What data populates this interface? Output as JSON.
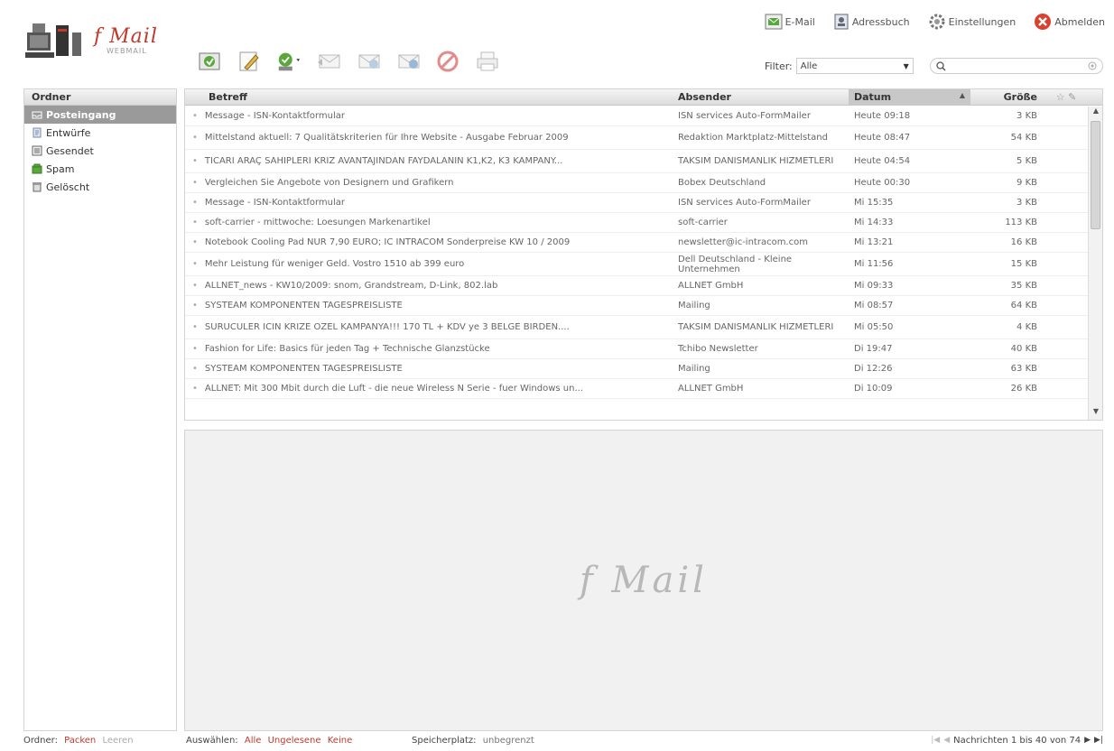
{
  "logo": {
    "name": "f Mail",
    "sub": "WEBMAIL"
  },
  "topnav": [
    {
      "label": "E-Mail",
      "icon": "email-icon"
    },
    {
      "label": "Adressbuch",
      "icon": "addressbook-icon"
    },
    {
      "label": "Einstellungen",
      "icon": "settings-icon"
    },
    {
      "label": "Abmelden",
      "icon": "logout-icon"
    }
  ],
  "filter": {
    "label": "Filter:",
    "value": "Alle"
  },
  "search": {
    "placeholder": ""
  },
  "folders": {
    "header": "Ordner",
    "items": [
      {
        "label": "Posteingang",
        "icon": "inbox-icon"
      },
      {
        "label": "Entwürfe",
        "icon": "drafts-icon"
      },
      {
        "label": "Gesendet",
        "icon": "sent-icon"
      },
      {
        "label": "Spam",
        "icon": "spam-icon"
      },
      {
        "label": "Gelöscht",
        "icon": "trash-icon"
      }
    ]
  },
  "list": {
    "columns": {
      "subject": "Betreff",
      "sender": "Absender",
      "date": "Datum",
      "size": "Größe"
    },
    "rows": [
      {
        "subject": "Message - ISN-Kontaktformular",
        "sender": "ISN services Auto-FormMailer",
        "date": "Heute 09:18",
        "size": "3 KB"
      },
      {
        "subject": "Mittelstand aktuell: 7 Qualitätskriterien für Ihre Website - Ausgabe Februar 2009",
        "sender": "Redaktion Marktplatz-Mittelstand",
        "date": "Heute 08:47",
        "size": "54 KB"
      },
      {
        "subject": "TICARI ARAÇ SAHIPLERI KRIZ AVANTAJINDAN FAYDALANIN K1,K2, K3 KAMPANY...",
        "sender": "TAKSIM DANISMANLIK HIZMETLERI",
        "date": "Heute 04:54",
        "size": "5 KB"
      },
      {
        "subject": "Vergleichen Sie Angebote von Designern und Grafikern",
        "sender": "Bobex Deutschland",
        "date": "Heute 00:30",
        "size": "9 KB"
      },
      {
        "subject": "Message - ISN-Kontaktformular",
        "sender": "ISN services Auto-FormMailer",
        "date": "Mi 15:35",
        "size": "3 KB"
      },
      {
        "subject": "soft-carrier - mittwoche: Loesungen Markenartikel",
        "sender": "soft-carrier",
        "date": "Mi 14:33",
        "size": "113 KB"
      },
      {
        "subject": "Notebook Cooling Pad NUR 7,90 EURO; IC INTRACOM Sonderpreise KW 10 / 2009",
        "sender": "newsletter@ic-intracom.com",
        "date": "Mi 13:21",
        "size": "16 KB"
      },
      {
        "subject": "Mehr Leistung für weniger Geld. Vostro 1510 ab 399 euro",
        "sender": "Dell Deutschland - Kleine Unternehmen",
        "date": "Mi 11:56",
        "size": "15 KB"
      },
      {
        "subject": "ALLNET_news - KW10/2009: snom, Grandstream, D-Link, 802.lab",
        "sender": "ALLNET GmbH",
        "date": "Mi 09:33",
        "size": "35 KB"
      },
      {
        "subject": "SYSTEAM KOMPONENTEN TAGESPREISLISTE",
        "sender": "Mailing",
        "date": "Mi 08:57",
        "size": "64 KB"
      },
      {
        "subject": "SURUCULER ICIN KRIZE OZEL KAMPANYA!!! 170 TL + KDV ye 3 BELGE BIRDEN....",
        "sender": "TAKSIM DANISMANLIK HIZMETLERI",
        "date": "Mi 05:50",
        "size": "4 KB"
      },
      {
        "subject": "Fashion for Life: Basics für jeden Tag + Technische Glanzstücke",
        "sender": "Tchibo Newsletter",
        "date": "Di 19:47",
        "size": "40 KB"
      },
      {
        "subject": "SYSTEAM KOMPONENTEN TAGESPREISLISTE",
        "sender": "Mailing",
        "date": "Di 12:26",
        "size": "63 KB"
      },
      {
        "subject": "ALLNET: Mit 300 Mbit durch die Luft - die neue Wireless N Serie - fuer Windows un...",
        "sender": "ALLNET GmbH",
        "date": "Di 10:09",
        "size": "26 KB"
      }
    ]
  },
  "preview": {
    "logo": "f Mail"
  },
  "footer": {
    "folder_label": "Ordner:",
    "compact": "Packen",
    "empty": "Leeren",
    "select_label": "Auswählen:",
    "select_all": "Alle",
    "select_unread": "Ungelesene",
    "select_none": "Keine",
    "storage_label": "Speicherplatz:",
    "storage_value": "unbegrenzt",
    "pagination": "Nachrichten 1 bis 40 von 74"
  },
  "colors": {
    "accent": "#c0392b",
    "active_folder": "#9a9a9a"
  }
}
